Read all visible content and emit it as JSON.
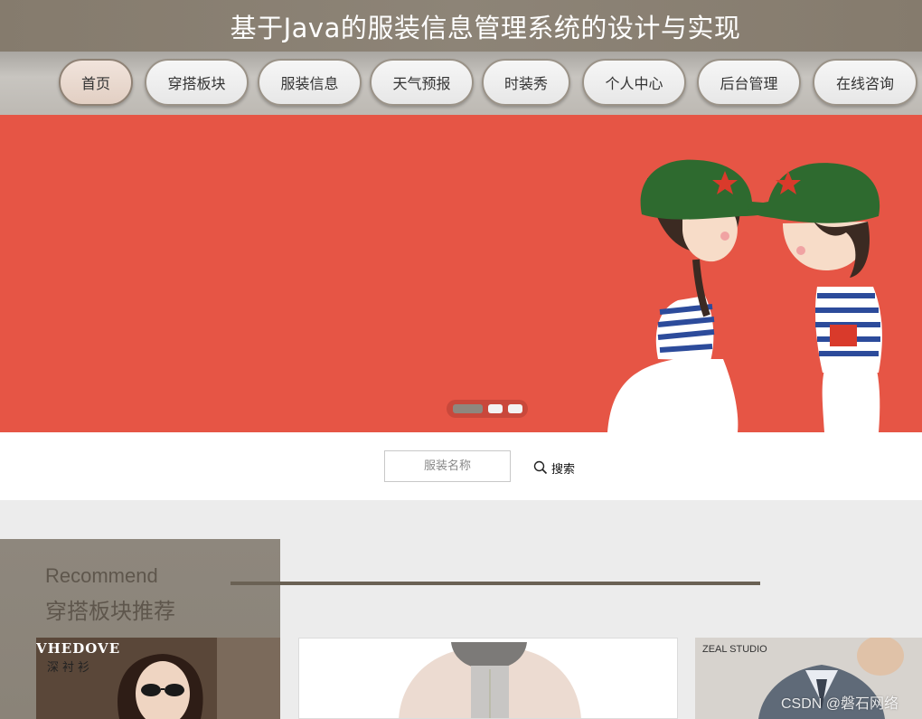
{
  "header": {
    "title": "基于Java的服装信息管理系统的设计与实现"
  },
  "nav": {
    "items": [
      {
        "label": "首页",
        "active": true
      },
      {
        "label": "穿搭板块"
      },
      {
        "label": "服装信息"
      },
      {
        "label": "天气预报"
      },
      {
        "label": "时装秀"
      },
      {
        "label": "个人中心"
      },
      {
        "label": "后台管理"
      },
      {
        "label": "在线咨询"
      }
    ]
  },
  "banner": {
    "bg_color": "#e65545",
    "slide_count": 3,
    "current_slide": 1
  },
  "search": {
    "placeholder": "服装名称",
    "button_label": "搜索",
    "icon": "search-icon"
  },
  "recommend": {
    "title_en": "Recommend",
    "title_cn": "穿搭板块推荐"
  },
  "cards": [
    {
      "brand": "VHEDOVE",
      "brand_sub": "深衬衫"
    },
    {
      "brand": ""
    },
    {
      "brand": "ZEAL STUDIO"
    }
  ],
  "watermark": "CSDN @磐石网络",
  "colors": {
    "header": "#857b6d",
    "banner": "#e65545",
    "accent_line": "#6a6154"
  }
}
